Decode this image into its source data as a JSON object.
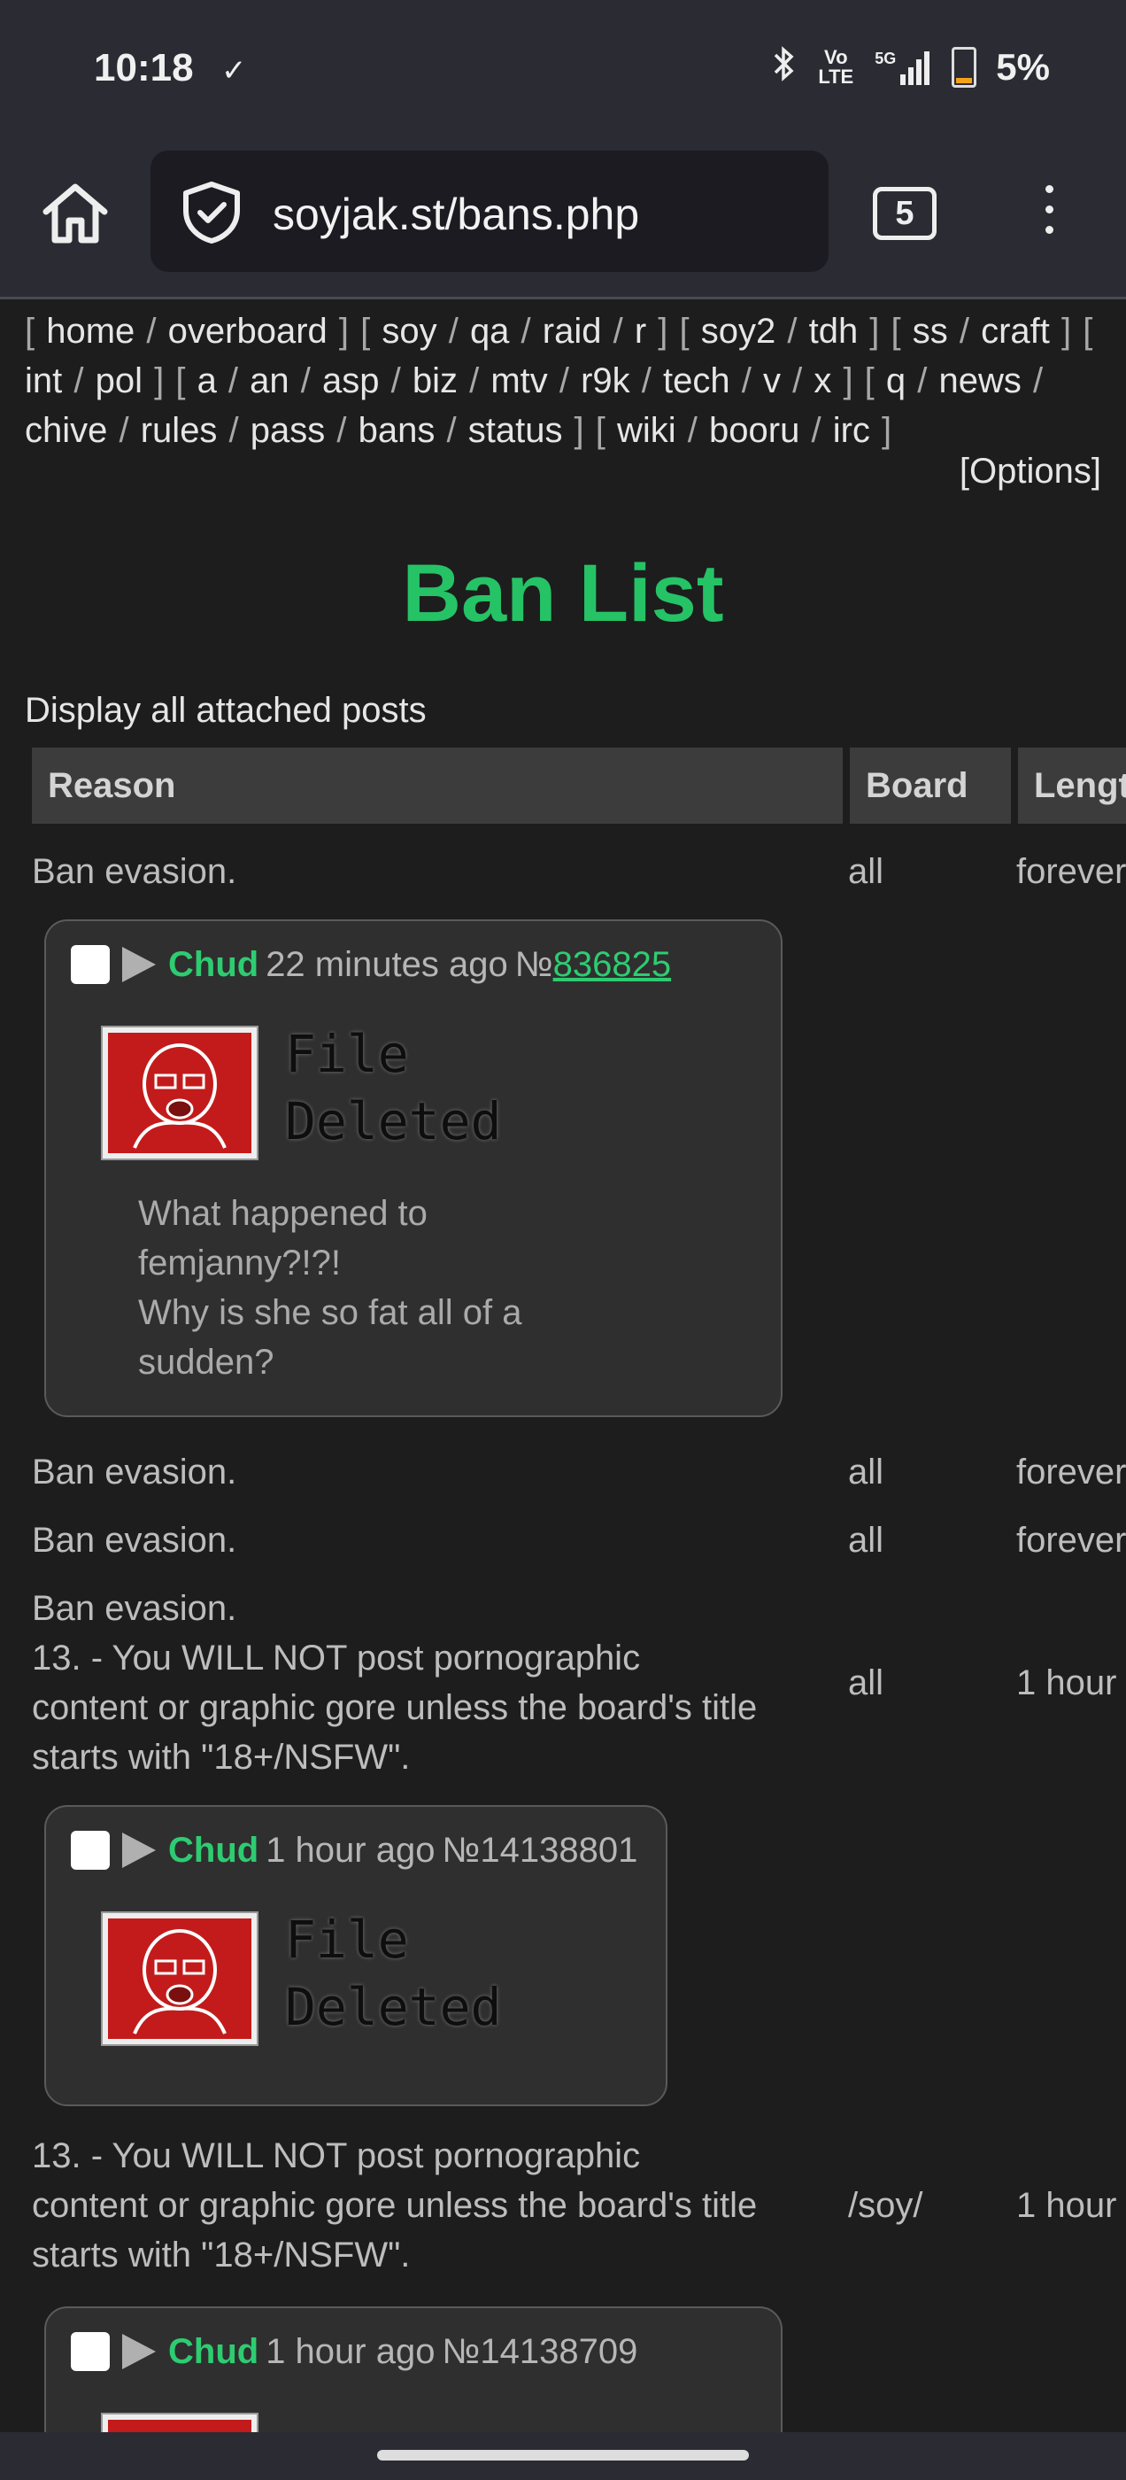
{
  "status_bar": {
    "time": "10:18",
    "download_icon": "✓",
    "volte": "Vo LTE",
    "signal": "5G",
    "battery": "5%"
  },
  "browser": {
    "url": "soyjak.st/bans.php",
    "tab_count": "5",
    "home_icon": "home-icon",
    "shield_icon": "shield-check-icon",
    "menu_icon": "kebab-menu-icon"
  },
  "boardlist": {
    "groups": [
      [
        "home",
        "overboard"
      ],
      [
        "soy",
        "qa",
        "raid",
        "r"
      ],
      [
        "soy2",
        "tdh"
      ],
      [
        "ss",
        "craft"
      ],
      [
        "int",
        "pol"
      ],
      [
        "a",
        "an",
        "asp",
        "biz",
        "mtv",
        "r9k",
        "tech",
        "v",
        "x"
      ],
      [
        "q",
        "news",
        "chive",
        "rules",
        "pass",
        "bans",
        "status"
      ],
      [
        "wiki",
        "booru",
        "irc"
      ]
    ],
    "options": "[Options]"
  },
  "page": {
    "title": "Ban List",
    "display_all": "Display all attached posts",
    "columns": {
      "reason": "Reason",
      "board": "Board",
      "length": "Length"
    }
  },
  "bans": [
    {
      "reason": "Ban evasion.",
      "board": "all",
      "length": "forever"
    },
    {
      "reason": "Ban evasion.",
      "board": "all",
      "length": "forever"
    },
    {
      "reason": "Ban evasion.",
      "board": "all",
      "length": "forever"
    },
    {
      "reason": "Ban evasion.\n13. - You WILL NOT post pornographic content or graphic gore unless the board's title starts with \"18+/NSFW\".",
      "board": "all",
      "length": "1 hour"
    },
    {
      "reason": "13. - You WILL NOT post pornographic content or graphic gore unless the board's title starts with \"18+/NSFW\".",
      "board": "/soy/",
      "length": "1 hour"
    }
  ],
  "posts": [
    {
      "name": "Chud",
      "time": "22 minutes ago",
      "no_prefix": "№",
      "no": "836825",
      "file_text": "File\nDeleted",
      "message": "What happened to femjanny?!?!\nWhy is she so fat all of a sudden?"
    },
    {
      "name": "Chud",
      "time": "1 hour ago",
      "no_prefix": "№",
      "no": "14138801",
      "file_text": "File\nDeleted",
      "message": ""
    },
    {
      "name": "Chud",
      "time": "1 hour ago",
      "no_prefix": "№",
      "no": "14138709",
      "file_text": "",
      "message": ""
    }
  ]
}
